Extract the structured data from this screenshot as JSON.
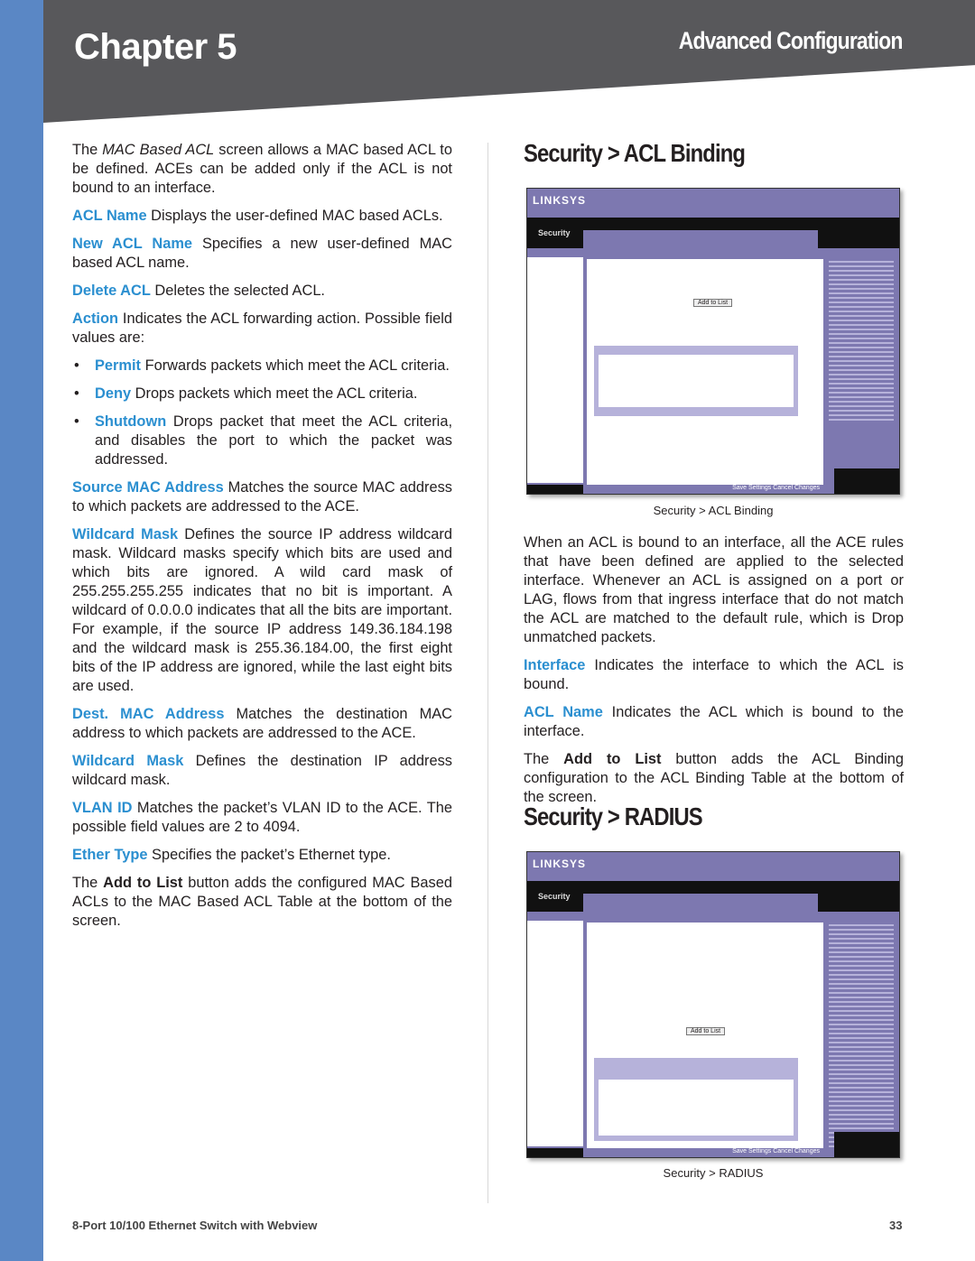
{
  "header": {
    "chapter": "Chapter 5",
    "section": "Advanced Configuration"
  },
  "left": {
    "intro": {
      "pre": "The ",
      "em": "MAC Based ACL",
      "post": " screen allows a MAC based ACL to be defined. ACEs can be added only if the ACL is not bound to an interface."
    },
    "items": [
      {
        "term": "ACL Name",
        "text": " Displays the user-defined MAC based ACLs."
      },
      {
        "term": "New ACL Name",
        "text": " Specifies a new user-defined MAC based ACL name."
      },
      {
        "term": "Delete ACL",
        "text": " Deletes the selected ACL."
      },
      {
        "term": "Action",
        "text": " Indicates the ACL forwarding action. Possible field values are:"
      }
    ],
    "bullets": [
      {
        "term": "Permit",
        "text": " Forwards packets which meet the ACL criteria."
      },
      {
        "term": "Deny",
        "text": " Drops packets which meet the ACL criteria."
      },
      {
        "term": "Shutdown",
        "text": " Drops packet that meet the ACL criteria, and disables the port to which the packet was addressed."
      }
    ],
    "items2": [
      {
        "term": "Source MAC Address",
        "text": " Matches the source MAC address to which packets are addressed to the ACE."
      },
      {
        "term": "Wildcard Mask",
        "text": " Defines the source IP address wildcard mask. Wildcard masks specify which bits are used and which bits are ignored. A wild card mask of 255.255.255.255 indicates that no bit is important. A wildcard of 0.0.0.0 indicates that all the bits are important. For example, if the source IP address 149.36.184.198 and the wildcard mask is 255.36.184.00, the first eight bits of the IP address are ignored, while the last eight bits are used."
      },
      {
        "term": "Dest. MAC Address",
        "text": " Matches the destination MAC address to which packets are addressed to the ACE."
      },
      {
        "term": "Wildcard Mask",
        "text": " Defines the destination IP address wildcard mask."
      },
      {
        "term": "VLAN ID",
        "text": " Matches the packet’s VLAN ID to the ACE. The possible field values are 2 to 4094."
      },
      {
        "term": "Ether Type",
        "text": " Specifies the packet’s Ethernet type."
      }
    ],
    "outro": {
      "pre": "The ",
      "bold": "Add to List",
      "post": " button adds the configured MAC Based ACLs to the MAC Based ACL Table at the bottom of the screen."
    }
  },
  "right": {
    "heading1": "Security > ACL Binding",
    "shot1": {
      "logo": "LINKSYS",
      "section": "Security",
      "button": "Add to List",
      "footer": "Save Settings  Cancel Changes"
    },
    "caption1": "Security > ACL Binding",
    "para1": "When an ACL is bound to an interface, all the ACE rules that have been defined are applied to the selected interface. Whenever an ACL is assigned on a port or LAG, flows from that ingress interface that do not match the ACL are matched to the default rule, which is Drop unmatched packets.",
    "items": [
      {
        "term": "Interface",
        "text": " Indicates the interface to which the ACL is bound."
      },
      {
        "term": "ACL Name",
        "text": " Indicates the ACL which is bound to the interface."
      }
    ],
    "outro": {
      "pre": "The ",
      "bold": "Add to List",
      "post": " button adds the ACL Binding configuration to the ACL Binding Table at the bottom of the screen."
    },
    "heading2": "Security > RADIUS",
    "shot2": {
      "logo": "LINKSYS",
      "section": "Security",
      "button": "Add to List",
      "footer": "Save Settings  Cancel Changes"
    },
    "caption2": "Security > RADIUS"
  },
  "footer": {
    "product": "8-Port 10/100 Ethernet Switch with Webview",
    "page": "33"
  }
}
